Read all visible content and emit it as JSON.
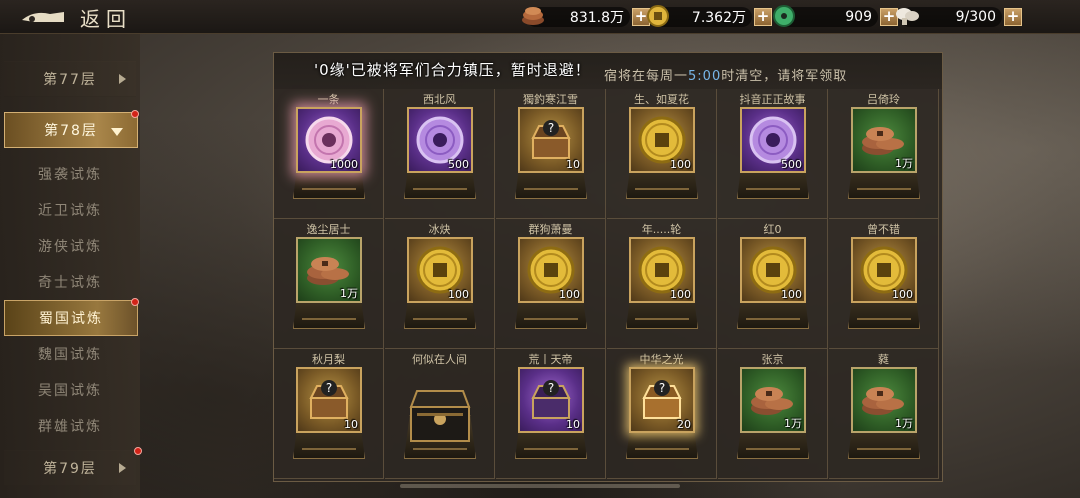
{
  "topbar": {
    "back_label": "返回",
    "resources": [
      {
        "icon": "copper-ingot-icon",
        "value": "831.8万"
      },
      {
        "icon": "gold-coin-icon",
        "value": "7.362万"
      },
      {
        "icon": "jade-icon",
        "value": "909"
      },
      {
        "icon": "mushroom-icon",
        "value": "9/300"
      }
    ],
    "plus": "+"
  },
  "sidebar": {
    "items": [
      {
        "label": "第77层",
        "kind": "floor"
      },
      {
        "label": "第78层",
        "kind": "floor-active"
      },
      {
        "label": "强袭试炼",
        "kind": "sub"
      },
      {
        "label": "近卫试炼",
        "kind": "sub"
      },
      {
        "label": "游侠试炼",
        "kind": "sub"
      },
      {
        "label": "奇士试炼",
        "kind": "sub"
      },
      {
        "label": "蜀国试炼",
        "kind": "sub-selected"
      },
      {
        "label": "魏国试炼",
        "kind": "sub"
      },
      {
        "label": "吴国试炼",
        "kind": "sub"
      },
      {
        "label": "群雄试炼",
        "kind": "sub"
      },
      {
        "label": "第79层",
        "kind": "floor"
      }
    ]
  },
  "banner": {
    "overlay_text": "'0缘'已被将军们合力镇压，暂时退避！",
    "notice_pre": "宿将在每周一",
    "notice_time": "5:00",
    "notice_post": "时清空，请将军领取"
  },
  "rewards": [
    {
      "name": "一条",
      "type": "jade-disc-pink",
      "qty": "1000"
    },
    {
      "name": "西北风",
      "type": "jade-disc-purple",
      "qty": "500"
    },
    {
      "name": "獨釣寒江雪",
      "type": "mystery-chest-gold",
      "qty": "10"
    },
    {
      "name": "生、如夏花",
      "type": "gold-coin",
      "qty": "100"
    },
    {
      "name": "抖音正正故事",
      "type": "jade-disc-purple",
      "qty": "500"
    },
    {
      "name": "吕倚玲",
      "type": "copper-coins",
      "qty": "1万"
    },
    {
      "name": "逸尘居士",
      "type": "copper-coins",
      "qty": "1万"
    },
    {
      "name": "冰炔",
      "type": "gold-coin",
      "qty": "100"
    },
    {
      "name": "群狗萧曼",
      "type": "gold-coin",
      "qty": "100"
    },
    {
      "name": "年.....轮",
      "type": "gold-coin",
      "qty": "100"
    },
    {
      "name": "红0",
      "type": "gold-coin",
      "qty": "100"
    },
    {
      "name": "曾不错",
      "type": "gold-coin",
      "qty": "100"
    },
    {
      "name": "秋月梨",
      "type": "mystery-chest-gold",
      "qty": "10"
    },
    {
      "name": "何似在人间",
      "type": "open-chest",
      "qty": ""
    },
    {
      "name": "荒丨天帝",
      "type": "mystery-chest-purple",
      "qty": "10"
    },
    {
      "name": "中华之光",
      "type": "mystery-chest-glow",
      "qty": "20"
    },
    {
      "name": "张京",
      "type": "copper-coins",
      "qty": "1万"
    },
    {
      "name": "蕤",
      "type": "copper-coins",
      "qty": "1万"
    }
  ]
}
